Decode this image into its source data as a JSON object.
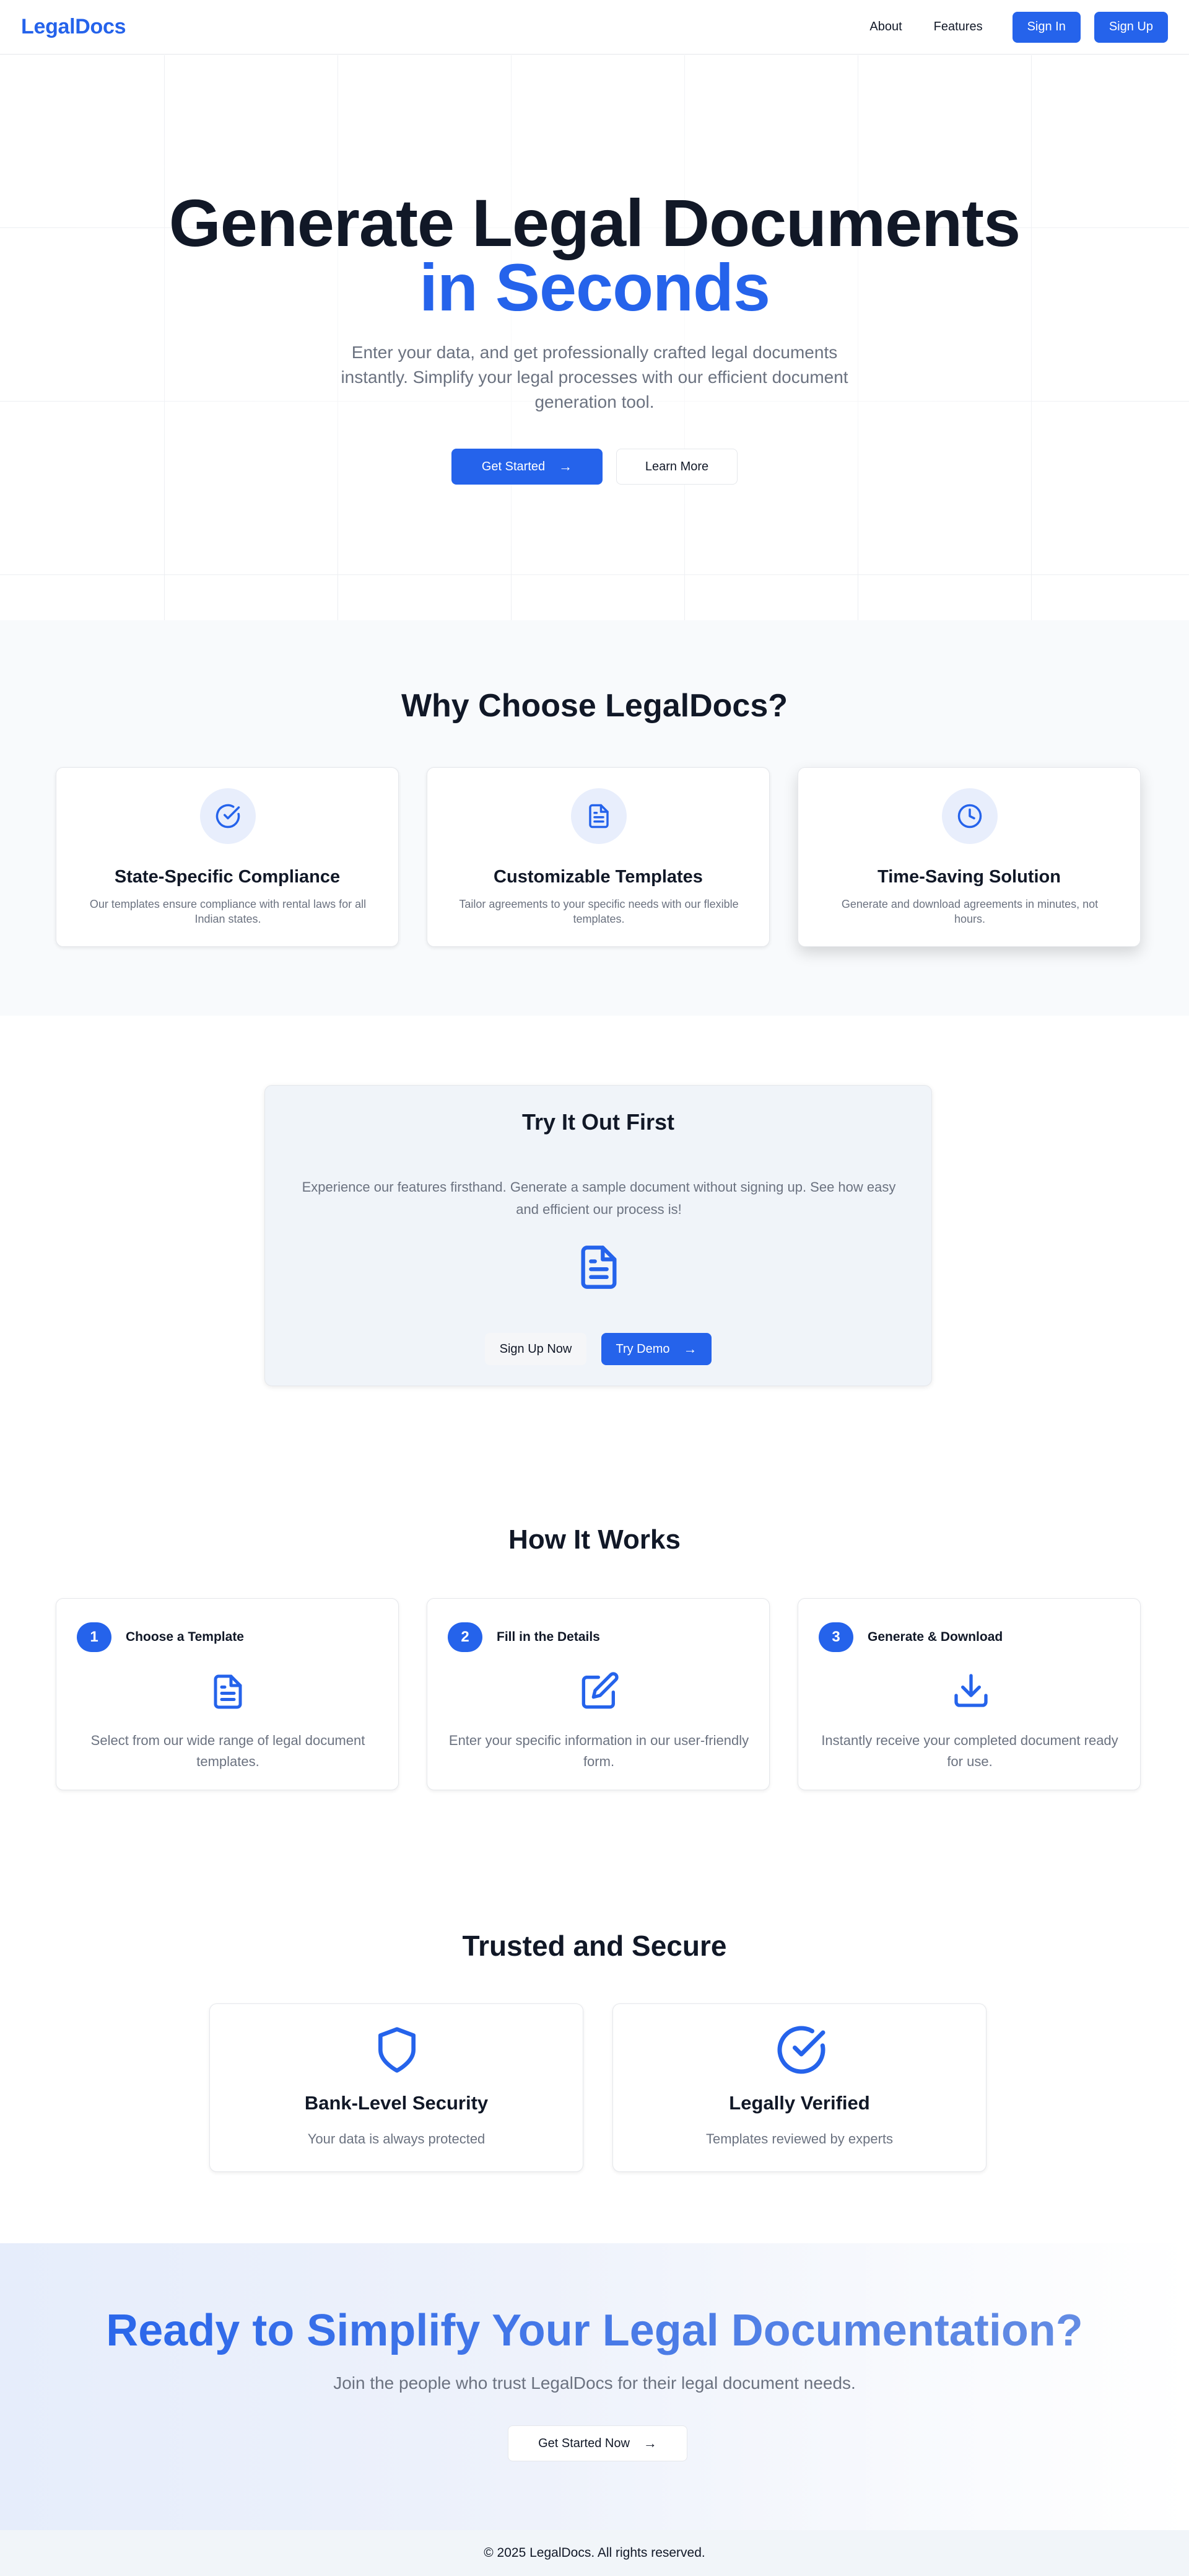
{
  "nav": {
    "logo": "LegalDocs",
    "links": [
      "About",
      "Features"
    ],
    "sign_in": "Sign In",
    "sign_up": "Sign Up"
  },
  "hero": {
    "title_line1": "Generate Legal Documents",
    "title_line2": "in Seconds",
    "subtitle": "Enter your data, and get professionally crafted legal documents instantly. Simplify your legal processes with our efficient document generation tool.",
    "primary_button": "Get Started",
    "secondary_button": "Learn More"
  },
  "why": {
    "title": "Why Choose LegalDocs?",
    "features": [
      {
        "icon": "check-circle-icon",
        "title": "State-Specific Compliance",
        "description": "Our templates ensure compliance with rental laws for all Indian states."
      },
      {
        "icon": "document-icon",
        "title": "Customizable Templates",
        "description": "Tailor agreements to your specific needs with our flexible templates."
      },
      {
        "icon": "clock-icon",
        "title": "Time-Saving Solution",
        "description": "Generate and download agreements in minutes, not hours."
      }
    ]
  },
  "try": {
    "title": "Try It Out First",
    "description": "Experience our features firsthand. Generate a sample document without signing up. See how easy and efficient our process is!",
    "icon": "document-icon",
    "signup_button": "Sign Up Now",
    "demo_button": "Try Demo"
  },
  "how": {
    "title": "How It Works",
    "steps": [
      {
        "number": "1",
        "title": "Choose a Template",
        "icon": "document-icon",
        "description": "Select from our wide range of legal document templates."
      },
      {
        "number": "2",
        "title": "Fill in the Details",
        "icon": "edit-icon",
        "description": "Enter your specific information in our user-friendly form."
      },
      {
        "number": "3",
        "title": "Generate & Download",
        "icon": "download-icon",
        "description": "Instantly receive your completed document ready for use."
      }
    ]
  },
  "trust": {
    "title": "Trusted and Secure",
    "items": [
      {
        "icon": "shield-icon",
        "title": "Bank-Level Security",
        "description": "Your data is always protected"
      },
      {
        "icon": "check-circle-icon",
        "title": "Legally Verified",
        "description": "Templates reviewed by experts"
      }
    ]
  },
  "cta": {
    "title": "Ready to Simplify Your Legal Documentation?",
    "subtitle": "Join the people who trust LegalDocs for their legal document needs.",
    "button": "Get Started Now"
  },
  "footer": {
    "copyright": "© 2025 LegalDocs. All rights reserved."
  },
  "colors": {
    "accent": "#2563eb",
    "text": "#111827",
    "muted": "#6b7280"
  }
}
